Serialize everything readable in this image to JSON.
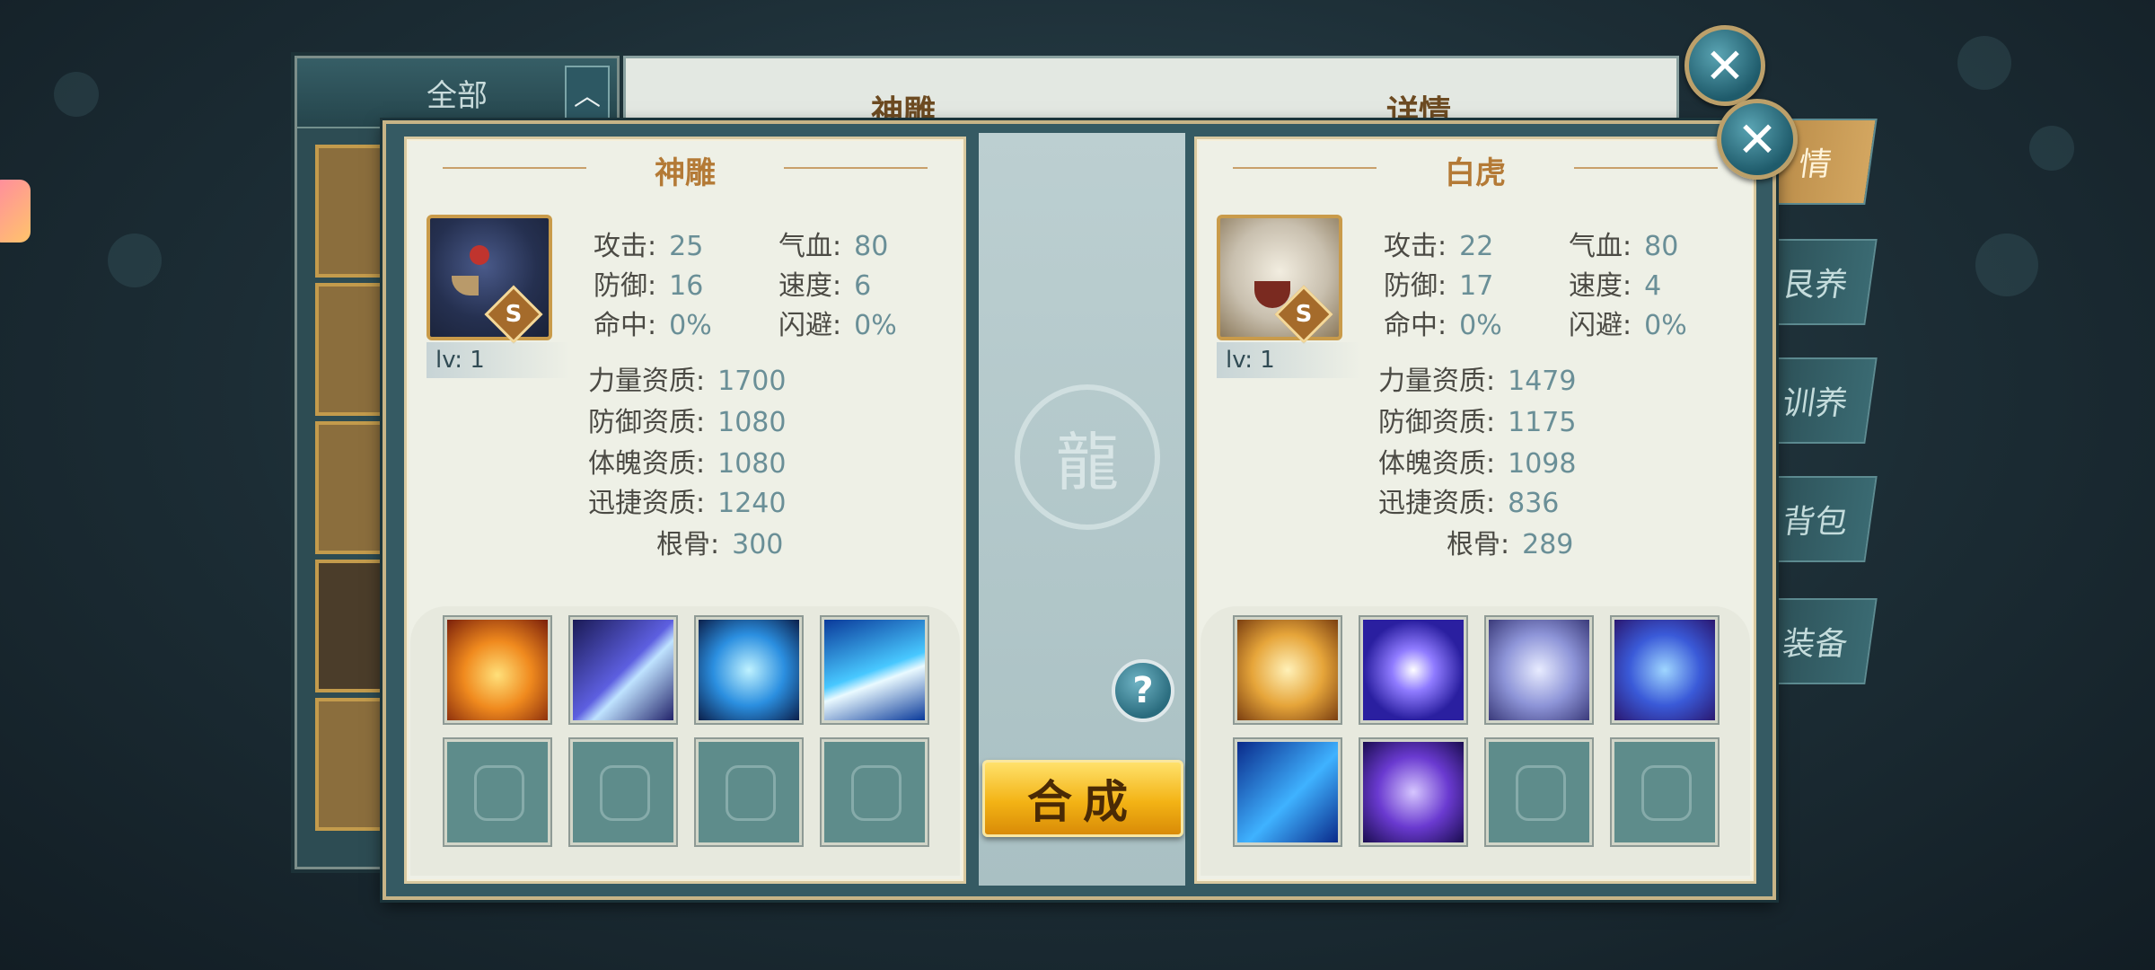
{
  "colors": {
    "accent_gold": "#b47a36",
    "stat_value": "#6a8f97",
    "panel_bg": "#eef0e6",
    "merge_button": "#f3b315"
  },
  "back_layer": {
    "filter_label": "全部",
    "filter_arrow": "︿",
    "main_title": "神雕",
    "detail_title": "详情",
    "side_tabs": [
      "情",
      "艮养",
      "训养",
      "背包",
      "装备"
    ]
  },
  "modal": {
    "help_label": "?",
    "merge_label": "合成",
    "close_label": "✕",
    "pets": [
      {
        "name": "神雕",
        "grade": "S",
        "level": "lv: 1",
        "attack_label": "攻击:",
        "attack": "25",
        "hp_label": "气血:",
        "hp": "80",
        "defense_label": "防御:",
        "defense": "16",
        "speed_label": "速度:",
        "speed": "6",
        "hit_label": "命中:",
        "hit": "0%",
        "dodge_label": "闪避:",
        "dodge": "0%",
        "str_q_label": "力量资质:",
        "str_q": "1700",
        "def_q_label": "防御资质:",
        "def_q": "1080",
        "con_q_label": "体魄资质:",
        "con_q": "1080",
        "agi_q_label": "迅捷资质:",
        "agi_q": "1240",
        "root_label": "根骨:",
        "root": "300",
        "skills": [
          "phoenix-fire-icon",
          "claw-slash-icon",
          "blue-heart-icon",
          "lightning-strike-icon",
          "empty",
          "empty",
          "empty",
          "empty"
        ]
      },
      {
        "name": "白虎",
        "grade": "S",
        "level": "lv: 1",
        "attack_label": "攻击:",
        "attack": "22",
        "hp_label": "气血:",
        "hp": "80",
        "defense_label": "防御:",
        "defense": "17",
        "speed_label": "速度:",
        "speed": "4",
        "hit_label": "命中:",
        "hit": "0%",
        "dodge_label": "闪避:",
        "dodge": "0%",
        "str_q_label": "力量资质:",
        "str_q": "1479",
        "def_q_label": "防御资质:",
        "def_q": "1175",
        "con_q_label": "体魄资质:",
        "con_q": "1098",
        "agi_q_label": "迅捷资质:",
        "agi_q": "836",
        "root_label": "根骨:",
        "root": "289",
        "skills": [
          "golden-lion-icon",
          "purple-orb-icon",
          "silver-vortex-icon",
          "shield-icon",
          "blue-beast-icon",
          "purple-swirl-icon",
          "empty",
          "empty"
        ]
      }
    ]
  }
}
